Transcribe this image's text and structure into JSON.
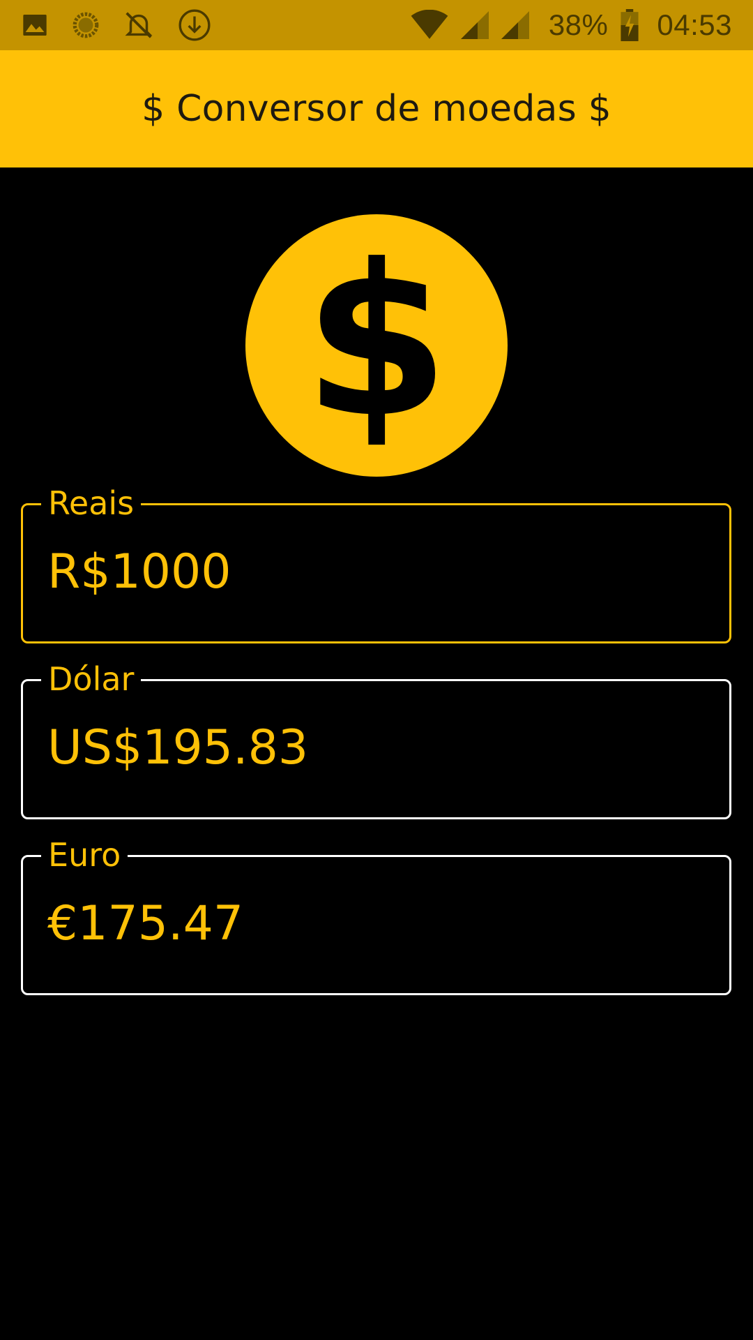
{
  "status_bar": {
    "icons_left": [
      "image-icon",
      "loading-icon",
      "notifications-off-icon",
      "download-icon"
    ],
    "icons_right": [
      "wifi-icon",
      "signal-icon",
      "signal-icon",
      "battery-charging-icon"
    ],
    "battery_percent": "38%",
    "time": "04:53"
  },
  "app_bar": {
    "title": "$ Conversor de moedas $"
  },
  "logo": {
    "icon": "dollar-coin-icon",
    "color": "#ffc107"
  },
  "fields": [
    {
      "label": "Reais",
      "value": "R$1000",
      "focused": true
    },
    {
      "label": "Dólar",
      "value": "US$195.83",
      "focused": false
    },
    {
      "label": "Euro",
      "value": "€175.47",
      "focused": false
    }
  ],
  "colors": {
    "accent": "#ffc107",
    "status_bar": "#c49300",
    "background": "#000000",
    "unfocused_border": "#ffffff"
  }
}
